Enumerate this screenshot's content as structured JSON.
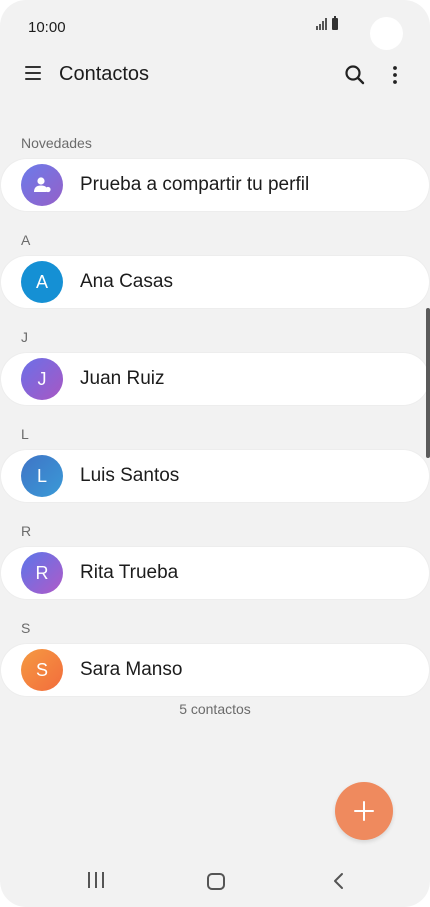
{
  "status_bar": {
    "time": "10:00"
  },
  "app_bar": {
    "title": "Contactos"
  },
  "sections": {
    "novedades": "Novedades",
    "a": "A",
    "j": "J",
    "l": "L",
    "r": "R",
    "s": "S"
  },
  "profile_card": {
    "label": "Prueba a compartir tu perfil",
    "icon": "share-profile-icon"
  },
  "contacts": [
    {
      "initial": "A",
      "name": "Ana Casas"
    },
    {
      "initial": "J",
      "name": "Juan Ruiz"
    },
    {
      "initial": "L",
      "name": "Luis Santos"
    },
    {
      "initial": "R",
      "name": "Rita Trueba"
    },
    {
      "initial": "S",
      "name": "Sara Manso"
    }
  ],
  "contact_count": "5 contactos",
  "colors": {
    "background": "#f2f2f2",
    "card": "#ffffff",
    "fab": "#ef8a5e",
    "avatar_ana": "#1590d4",
    "avatar_sara": "#f2813e"
  },
  "icons": {
    "menu": "hamburger-menu-icon",
    "search": "search-icon",
    "more": "more-options-icon",
    "fab": "plus-icon"
  }
}
